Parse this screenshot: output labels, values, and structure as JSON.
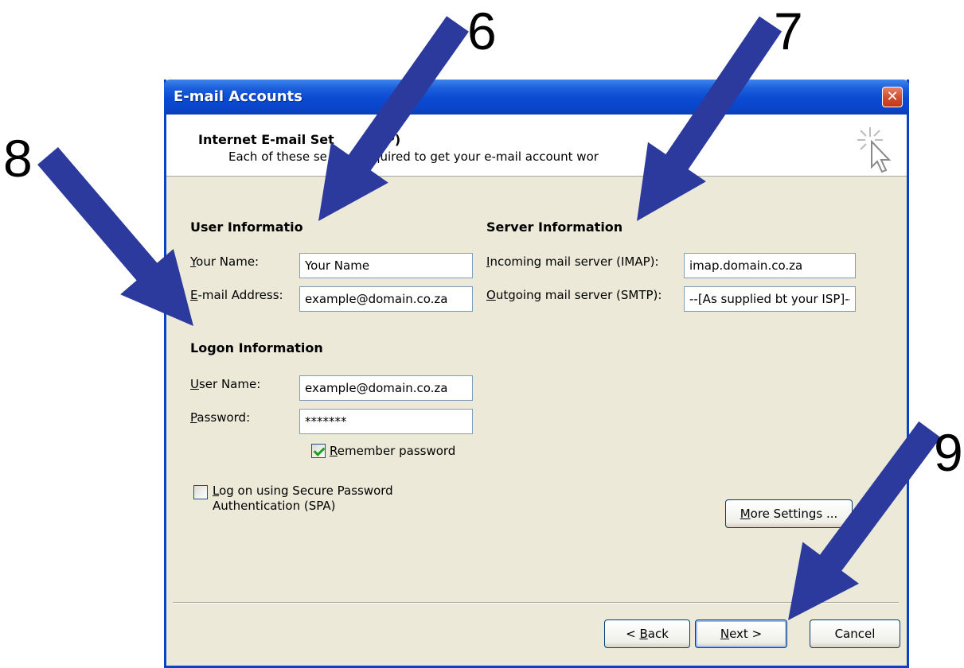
{
  "window": {
    "title": "E-mail Accounts",
    "close_glyph": "✕"
  },
  "header": {
    "title": "Internet E-mail Set",
    "title_end": "AP)",
    "subtitle": "Each of these se",
    "subtitle_mid": "required to get your e-mail account wor"
  },
  "user_info": {
    "heading": "User Informatio",
    "name_label_u": "Y",
    "name_label_rest": "our Name:",
    "name_value": "Your Name",
    "email_label_u": "E",
    "email_label_rest": "-mail Address:",
    "email_value": "example@domain.co.za"
  },
  "server_info": {
    "heading": "Server Information",
    "incoming_label_u": "I",
    "incoming_label_rest": "ncoming mail server (IMAP):",
    "incoming_value": "imap.domain.co.za",
    "outgoing_label_u": "O",
    "outgoing_label_rest": "utgoing mail server (SMTP):",
    "outgoing_value": "--[As supplied bt your ISP]--"
  },
  "logon_info": {
    "heading": "Logon Information",
    "user_label_u": "U",
    "user_label_rest": "ser Name:",
    "user_value": "example@domain.co.za",
    "password_label_u": "P",
    "password_label_rest": "assword:",
    "password_value": "*******",
    "remember_u": "R",
    "remember_rest": "emember password",
    "remember_checked": true,
    "spa_u": "L",
    "spa_rest_line1": "og on using Secure Password",
    "spa_line2": "Authentication (SPA)",
    "spa_checked": false
  },
  "buttons": {
    "more_settings_u": "M",
    "more_settings_rest": "ore Settings ...",
    "back_prefix": "< ",
    "back_u": "B",
    "back_rest": "ack",
    "next_u": "N",
    "next_rest": "ext >",
    "cancel": "Cancel"
  },
  "callouts": {
    "n6": "6",
    "n7": "7",
    "n8": "8",
    "n9": "9",
    "arrow_color": "#2b3a9c"
  }
}
